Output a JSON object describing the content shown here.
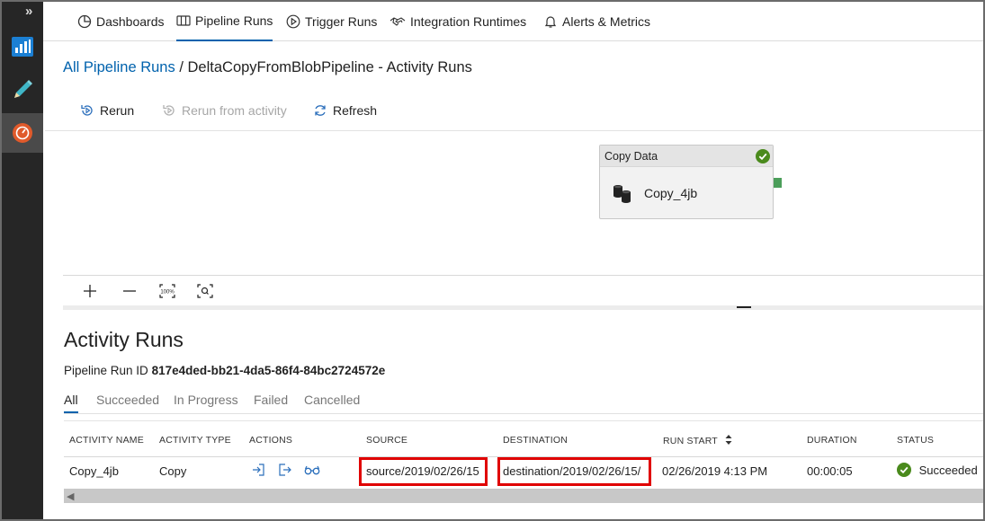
{
  "nav": {
    "expand_label": "»"
  },
  "tabs": [
    {
      "label": "Dashboards",
      "icon": "dashboard-icon"
    },
    {
      "label": "Pipeline Runs",
      "icon": "pipeline-runs-icon"
    },
    {
      "label": "Trigger Runs",
      "icon": "play-circle-icon"
    },
    {
      "label": "Integration Runtimes",
      "icon": "handshake-icon"
    },
    {
      "label": "Alerts & Metrics",
      "icon": "bell-icon"
    }
  ],
  "breadcrumb": {
    "link": "All Pipeline Runs",
    "separator": "/",
    "current": "DeltaCopyFromBlobPipeline - Activity Runs"
  },
  "toolbar": {
    "rerun": "Rerun",
    "rerun_from_activity": "Rerun from activity",
    "refresh": "Refresh"
  },
  "node": {
    "type": "Copy Data",
    "name": "Copy_4jb",
    "status_color": "#4a8a1c"
  },
  "zoom": {
    "zoom_in": "+",
    "zoom_out": "—",
    "reset_label": "100%"
  },
  "activity_runs": {
    "title": "Activity Runs",
    "run_id_label": "Pipeline Run ID",
    "run_id": "817e4ded-bb21-4da5-86f4-84bc2724572e",
    "filters": [
      "All",
      "Succeeded",
      "In Progress",
      "Failed",
      "Cancelled"
    ],
    "active_filter": "All",
    "columns": [
      "ACTIVITY NAME",
      "ACTIVITY TYPE",
      "ACTIONS",
      "SOURCE",
      "DESTINATION",
      "RUN START",
      "DURATION",
      "STATUS"
    ],
    "rows": [
      {
        "activity_name": "Copy_4jb",
        "activity_type": "Copy",
        "source": "source/2019/02/26/15",
        "destination": "destination/2019/02/26/15/",
        "run_start": "02/26/2019 4:13 PM",
        "duration": "00:00:05",
        "status": "Succeeded"
      }
    ]
  },
  "colors": {
    "accent": "#0062ad",
    "highlight": "#e00000",
    "success": "#4a8a1c",
    "nav_bg": "#262626"
  }
}
